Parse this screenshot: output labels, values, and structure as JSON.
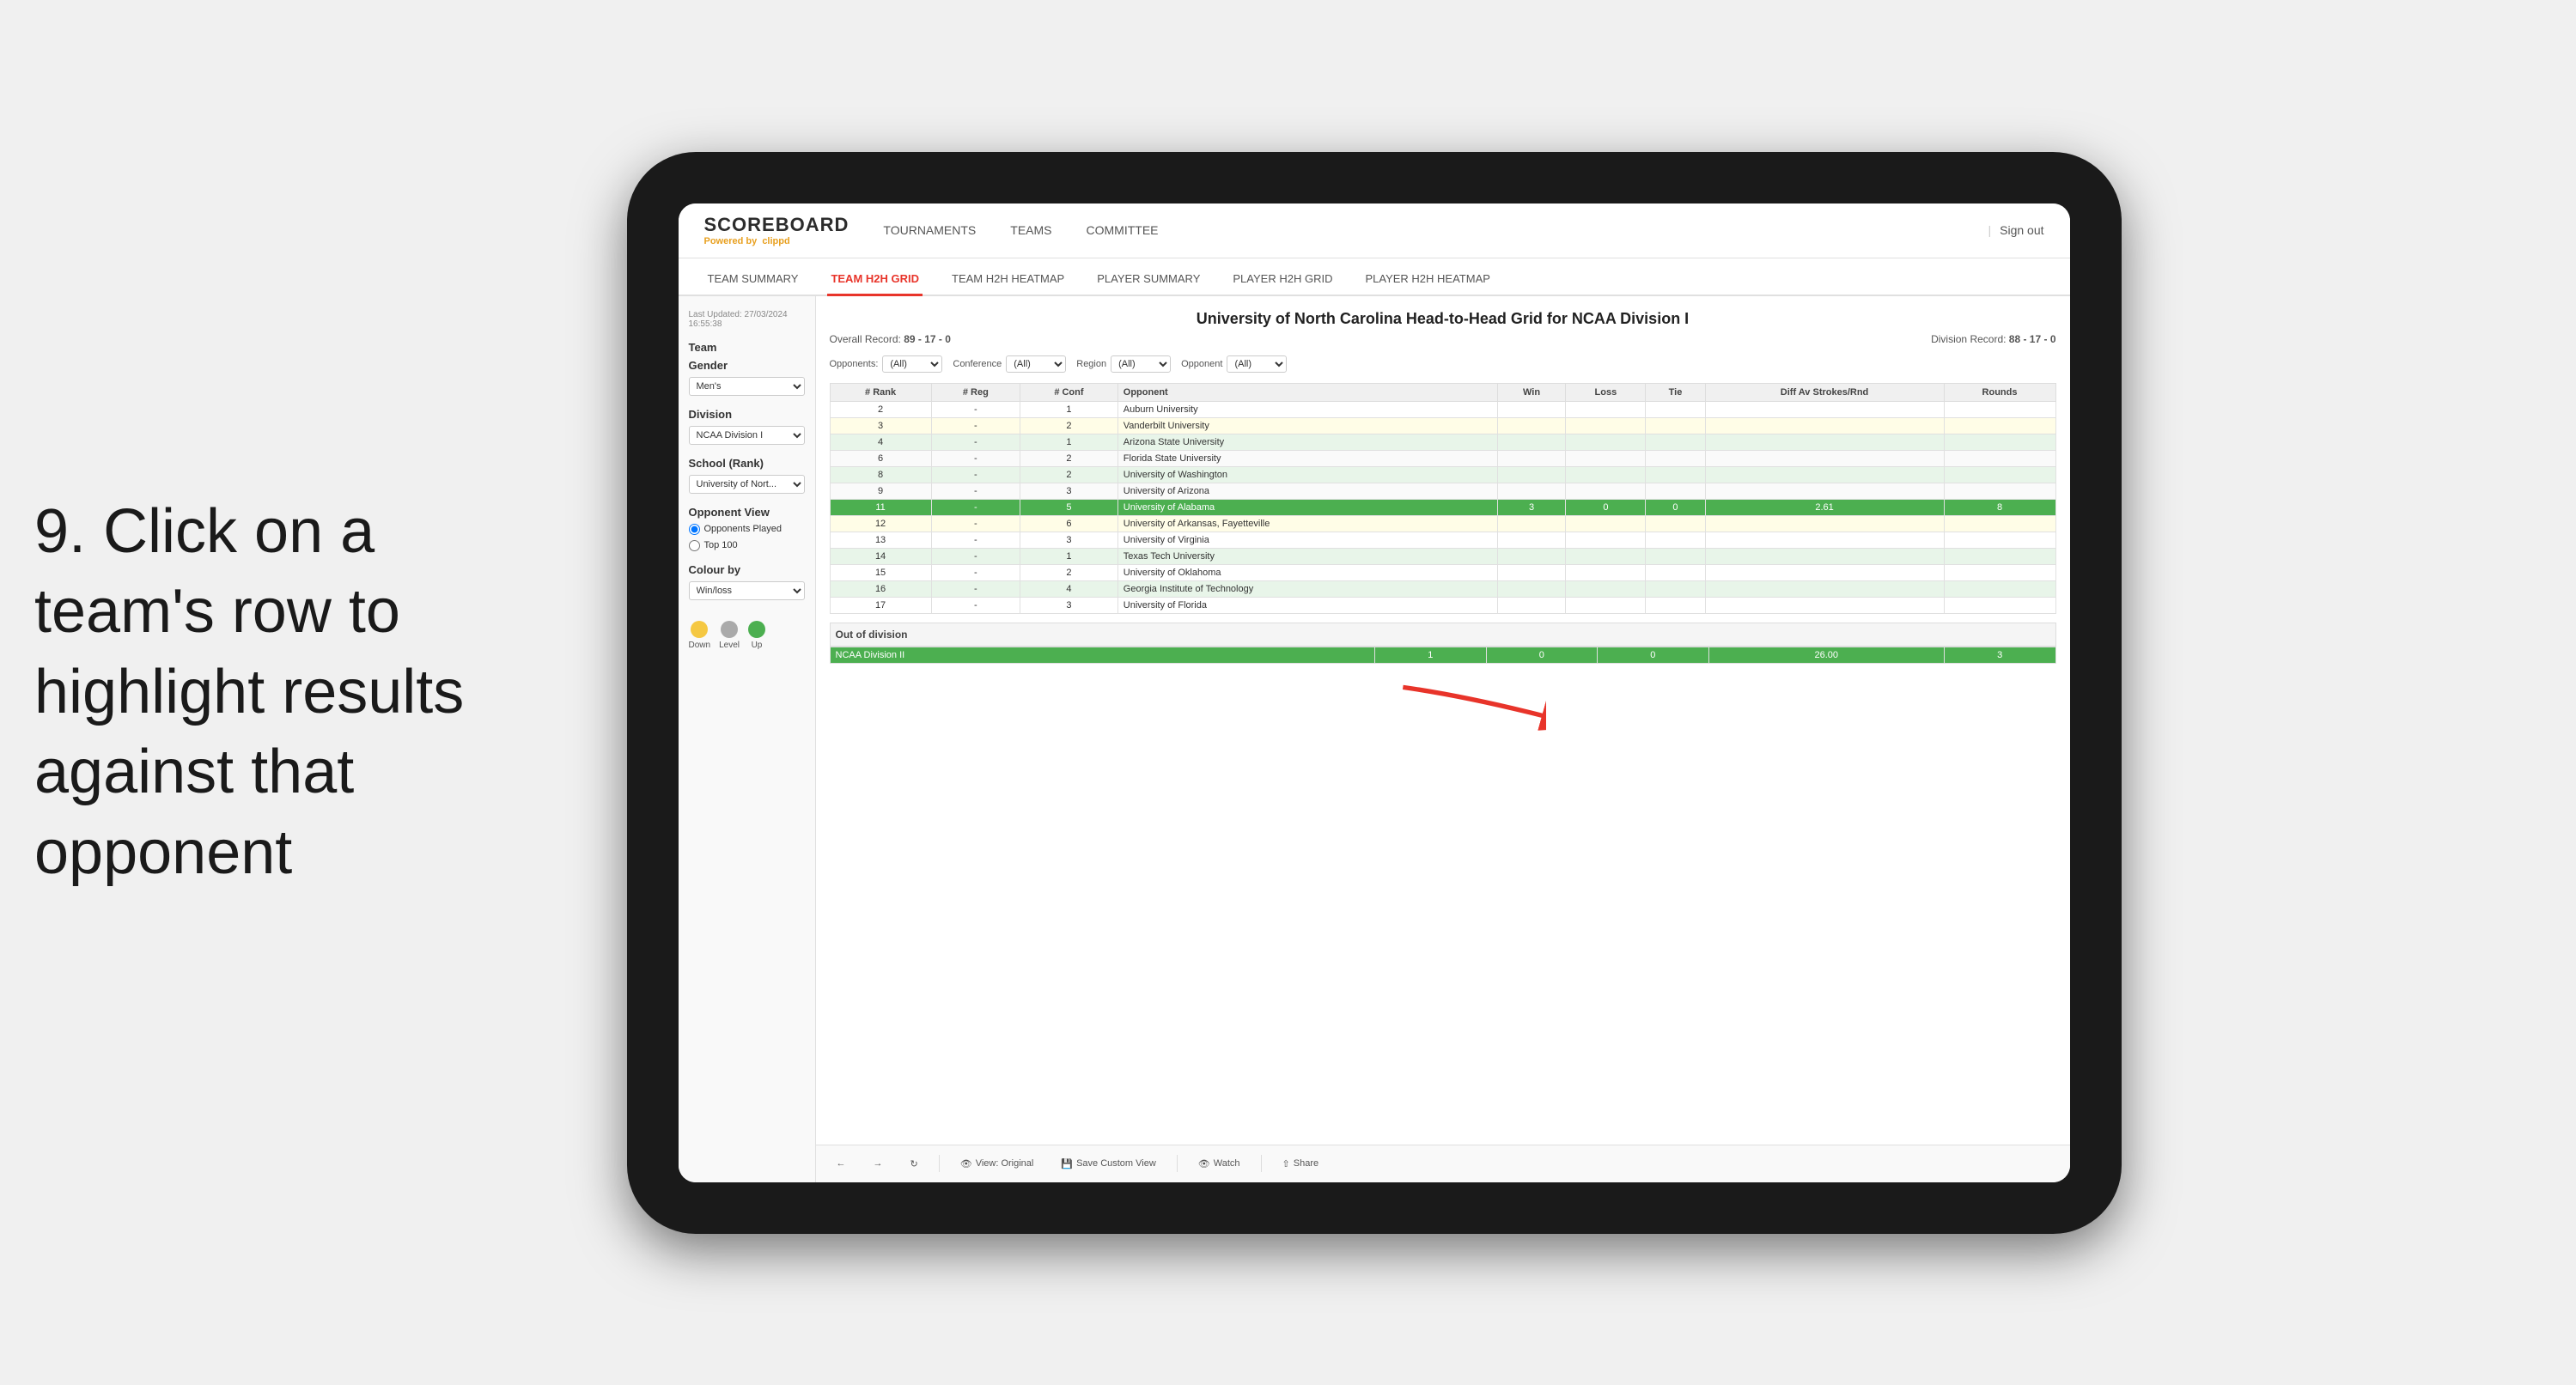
{
  "instruction": {
    "step": "9.",
    "text": "Click on a team's row to highlight results against that opponent"
  },
  "nav": {
    "logo": "SCOREBOARD",
    "logo_sub": "Powered by",
    "logo_brand": "clippd",
    "links": [
      "TOURNAMENTS",
      "TEAMS",
      "COMMITTEE"
    ],
    "sign_out": "Sign out"
  },
  "sub_tabs": [
    "TEAM SUMMARY",
    "TEAM H2H GRID",
    "TEAM H2H HEATMAP",
    "PLAYER SUMMARY",
    "PLAYER H2H GRID",
    "PLAYER H2H HEATMAP"
  ],
  "active_tab": "TEAM H2H GRID",
  "sidebar": {
    "last_updated_label": "Last Updated: 27/03/2024",
    "last_updated_time": "16:55:38",
    "team_label": "Team",
    "gender_label": "Gender",
    "gender_value": "Men's",
    "division_label": "Division",
    "division_value": "NCAA Division I",
    "school_label": "School (Rank)",
    "school_value": "University of Nort...",
    "opponent_view_label": "Opponent View",
    "radio1": "Opponents Played",
    "radio2": "Top 100",
    "colour_by_label": "Colour by",
    "colour_value": "Win/loss",
    "legend": {
      "down_label": "Down",
      "level_label": "Level",
      "up_label": "Up",
      "down_color": "#f5c842",
      "level_color": "#aaaaaa",
      "up_color": "#4caf50"
    }
  },
  "grid": {
    "title": "University of North Carolina Head-to-Head Grid for NCAA Division I",
    "overall_record": "89 - 17 - 0",
    "division_record": "88 - 17 - 0",
    "opponents_label": "Opponents:",
    "opponents_filter": "(All)",
    "conference_label": "Conference",
    "conference_filter": "(All)",
    "region_label": "Region",
    "region_filter": "(All)",
    "opponent_label": "Opponent",
    "opponent_filter": "(All)",
    "columns": [
      "# Rank",
      "# Reg",
      "# Conf",
      "Opponent",
      "Win",
      "Loss",
      "Tie",
      "Diff Av Strokes/Rnd",
      "Rounds"
    ],
    "rows": [
      {
        "rank": "2",
        "reg": "-",
        "conf": "1",
        "opponent": "Auburn University",
        "win": "",
        "loss": "",
        "tie": "",
        "diff": "",
        "rounds": "",
        "style": "normal"
      },
      {
        "rank": "3",
        "reg": "-",
        "conf": "2",
        "opponent": "Vanderbilt University",
        "win": "",
        "loss": "",
        "tie": "",
        "diff": "",
        "rounds": "",
        "style": "light-yellow"
      },
      {
        "rank": "4",
        "reg": "-",
        "conf": "1",
        "opponent": "Arizona State University",
        "win": "",
        "loss": "",
        "tie": "",
        "diff": "",
        "rounds": "",
        "style": "light-green"
      },
      {
        "rank": "6",
        "reg": "-",
        "conf": "2",
        "opponent": "Florida State University",
        "win": "",
        "loss": "",
        "tie": "",
        "diff": "",
        "rounds": "",
        "style": "normal"
      },
      {
        "rank": "8",
        "reg": "-",
        "conf": "2",
        "opponent": "University of Washington",
        "win": "",
        "loss": "",
        "tie": "",
        "diff": "",
        "rounds": "",
        "style": "light-green"
      },
      {
        "rank": "9",
        "reg": "-",
        "conf": "3",
        "opponent": "University of Arizona",
        "win": "",
        "loss": "",
        "tie": "",
        "diff": "",
        "rounds": "",
        "style": "normal"
      },
      {
        "rank": "11",
        "reg": "-",
        "conf": "5",
        "opponent": "University of Alabama",
        "win": "3",
        "loss": "0",
        "tie": "0",
        "diff": "2.61",
        "rounds": "8",
        "style": "highlighted"
      },
      {
        "rank": "12",
        "reg": "-",
        "conf": "6",
        "opponent": "University of Arkansas, Fayetteville",
        "win": "",
        "loss": "",
        "tie": "",
        "diff": "",
        "rounds": "",
        "style": "light-yellow"
      },
      {
        "rank": "13",
        "reg": "-",
        "conf": "3",
        "opponent": "University of Virginia",
        "win": "",
        "loss": "",
        "tie": "",
        "diff": "",
        "rounds": "",
        "style": "normal"
      },
      {
        "rank": "14",
        "reg": "-",
        "conf": "1",
        "opponent": "Texas Tech University",
        "win": "",
        "loss": "",
        "tie": "",
        "diff": "",
        "rounds": "",
        "style": "light-green"
      },
      {
        "rank": "15",
        "reg": "-",
        "conf": "2",
        "opponent": "University of Oklahoma",
        "win": "",
        "loss": "",
        "tie": "",
        "diff": "",
        "rounds": "",
        "style": "normal"
      },
      {
        "rank": "16",
        "reg": "-",
        "conf": "4",
        "opponent": "Georgia Institute of Technology",
        "win": "",
        "loss": "",
        "tie": "",
        "diff": "",
        "rounds": "",
        "style": "light-green"
      },
      {
        "rank": "17",
        "reg": "-",
        "conf": "3",
        "opponent": "University of Florida",
        "win": "",
        "loss": "",
        "tie": "",
        "diff": "",
        "rounds": "",
        "style": "normal"
      }
    ],
    "out_of_division_label": "Out of division",
    "out_of_division_row": {
      "division": "NCAA Division II",
      "win": "1",
      "loss": "0",
      "tie": "0",
      "diff": "26.00",
      "rounds": "3",
      "style": "highlighted"
    }
  },
  "toolbar": {
    "view_label": "View: Original",
    "save_custom": "Save Custom View",
    "watch": "Watch",
    "share": "Share"
  }
}
